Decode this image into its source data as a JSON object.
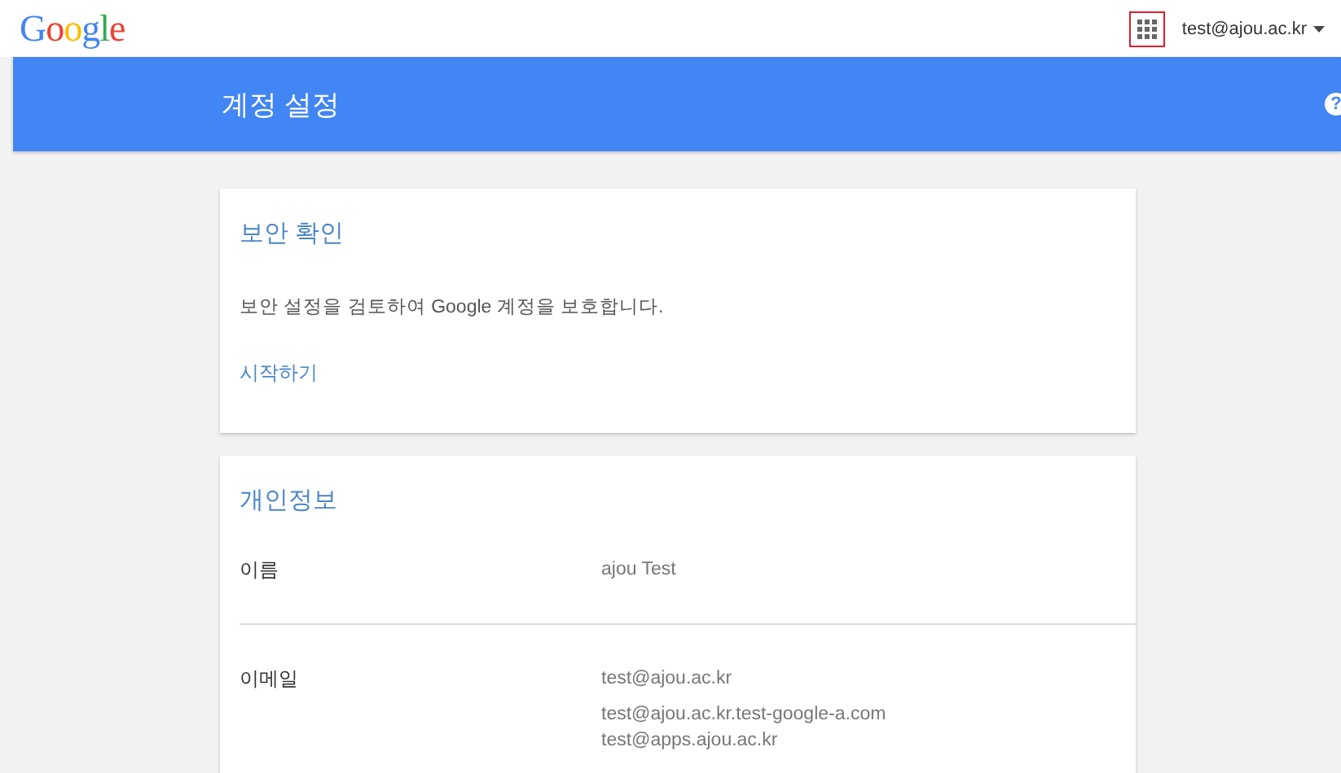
{
  "header": {
    "logo": "Google",
    "account": "test@ajou.ac.kr",
    "apps_highlighted": true
  },
  "banner": {
    "title": "계정 설정",
    "help": "?"
  },
  "security_card": {
    "title": "보안 확인",
    "description": "보안 설정을 검토하여 Google 계정을 보호합니다.",
    "link": "시작하기"
  },
  "personal_card": {
    "title": "개인정보",
    "rows": [
      {
        "label": "이름",
        "values": [
          "ajou Test"
        ]
      },
      {
        "label": "이메일",
        "values": [
          "test@ajou.ac.kr",
          "test@ajou.ac.kr.test-google-a.com",
          "test@apps.ajou.ac.kr"
        ]
      }
    ]
  }
}
